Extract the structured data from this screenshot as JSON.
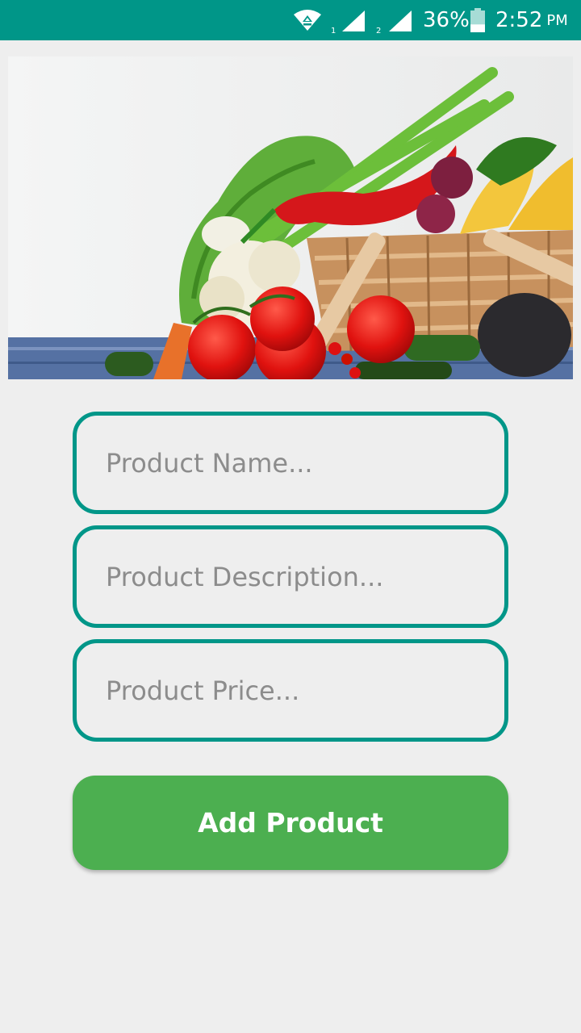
{
  "status_bar": {
    "wifi_icon": "wifi-icon",
    "sim1_label": "1",
    "sim2_label": "2",
    "battery_percent": "36%",
    "battery_level": 0.36,
    "time": "2:52",
    "ampm": "PM"
  },
  "hero": {
    "icon": "vegetable-basket-image"
  },
  "form": {
    "product_name_placeholder": "Product Name...",
    "product_description_placeholder": "Product Description...",
    "product_price_placeholder": "Product Price...",
    "product_name_value": "",
    "product_description_value": "",
    "product_price_value": ""
  },
  "actions": {
    "add_product_label": "Add Product"
  },
  "colors": {
    "status_bar": "#009688",
    "field_border": "#009688",
    "button": "#4caf50",
    "background": "#eeeeee"
  }
}
